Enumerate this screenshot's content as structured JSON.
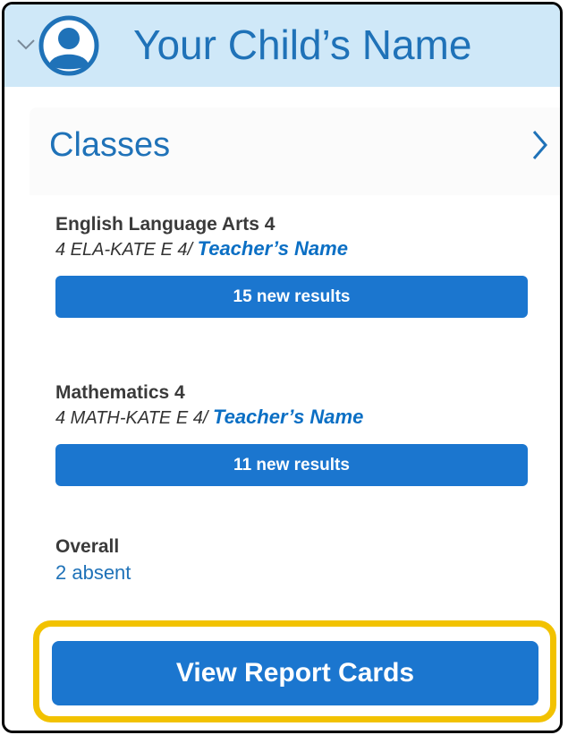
{
  "header": {
    "child_name": "Your Child’s Name",
    "icons": [
      "chevron-down-icon",
      "user-avatar-icon"
    ]
  },
  "classes_card": {
    "title": "Classes",
    "classes": [
      {
        "name": "English Language Arts 4",
        "section": "4 ELA-KATE E 4/",
        "teacher": "Teacher’s Name",
        "results_label": "15 new results"
      },
      {
        "name": "Mathematics 4",
        "section": "4 MATH-KATE E 4/",
        "teacher": "Teacher’s Name",
        "results_label": "11 new results"
      }
    ],
    "overall_label": "Overall",
    "absent_label": "2 absent"
  },
  "report_cards_button": "View Report Cards",
  "colors": {
    "accent": "#1b76cf",
    "header_bg": "#cfe8f8",
    "highlight": "#f2c200",
    "link_text": "#1f72b8"
  }
}
